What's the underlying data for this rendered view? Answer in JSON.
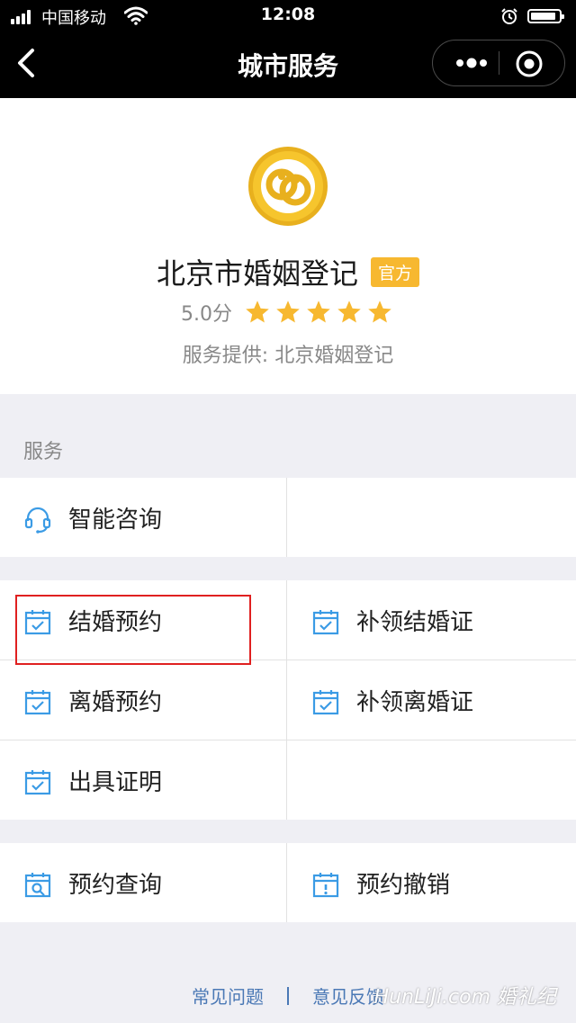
{
  "status_bar": {
    "carrier": "中国移动",
    "time": "12:08"
  },
  "nav": {
    "title": "城市服务"
  },
  "header": {
    "name": "北京市婚姻登记",
    "badge": "官方",
    "score": "5.0分",
    "rating": 5,
    "rating_max": 5,
    "provider_label": "服务提供:",
    "provider_value": "北京婚姻登记"
  },
  "section": {
    "label": "服务"
  },
  "services": {
    "smart_consult": "智能咨询",
    "marriage_booking": "结婚预约",
    "reissue_marriage": "补领结婚证",
    "divorce_booking": "离婚预约",
    "reissue_divorce": "补领离婚证",
    "certificate": "出具证明",
    "booking_query": "预约查询",
    "booking_cancel": "预约撤销"
  },
  "footer": {
    "faq": "常见问题",
    "feedback": "意见反馈"
  },
  "watermark": "HunLiJi.com 婚礼纪",
  "colors": {
    "accent_blue": "#3b9be5",
    "badge_yellow": "#f7b830",
    "star_yellow": "#f7b830",
    "highlight_red": "#e02020",
    "link_blue": "#4a78b5"
  }
}
